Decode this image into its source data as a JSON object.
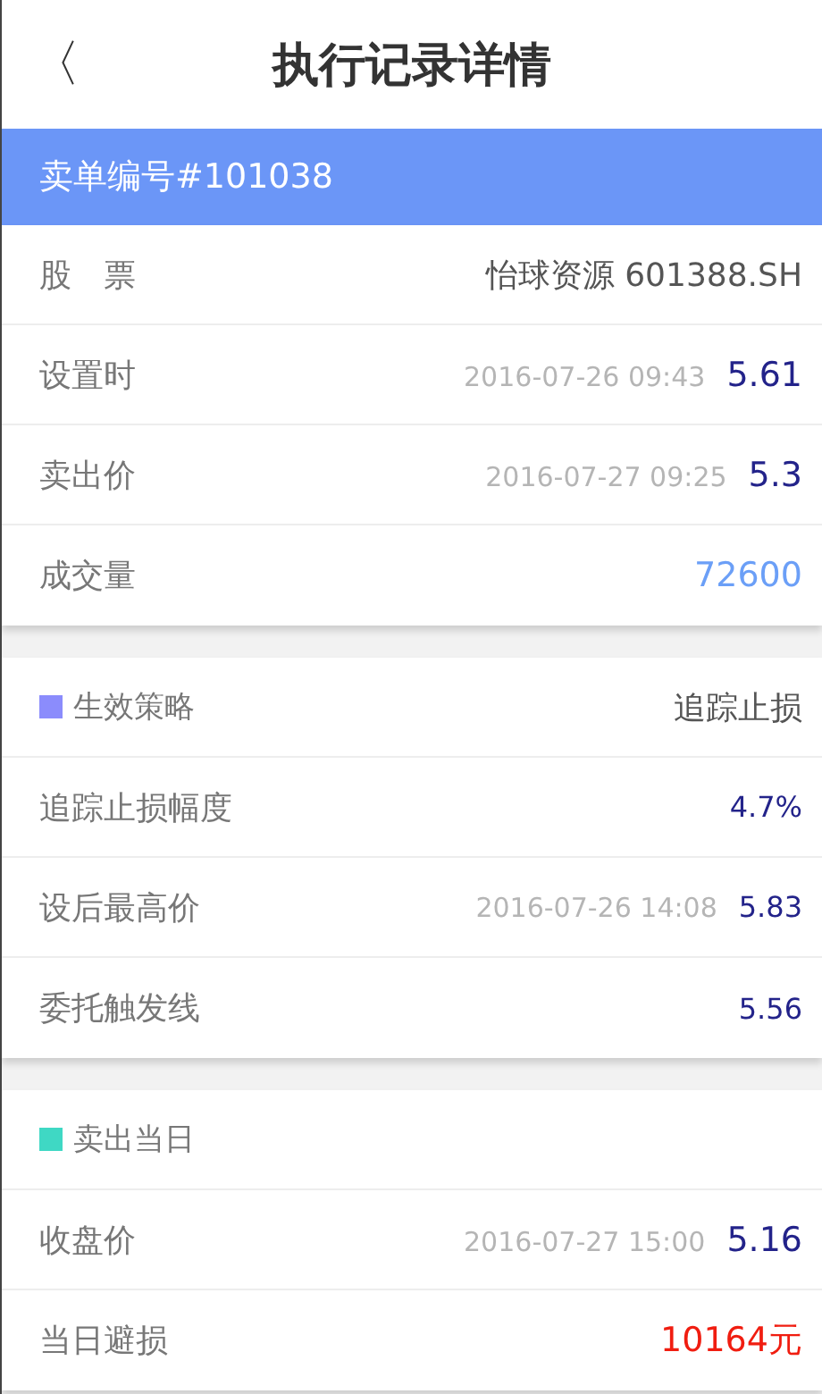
{
  "header": {
    "back": "〈",
    "title": "执行记录详情"
  },
  "order_bar": {
    "title": "卖单编号#101038"
  },
  "sections": [
    {
      "rows": [
        {
          "label": "股　票",
          "value": "怡球资源 601388.SH",
          "kind": "text"
        },
        {
          "label": "设置时",
          "time": "2016-07-26 09:43",
          "value": "5.61",
          "kind": "price"
        },
        {
          "label": "卖出价",
          "time": "2016-07-27 09:25",
          "value": "5.3",
          "kind": "price"
        },
        {
          "label": "成交量",
          "value": "72600",
          "kind": "volume"
        }
      ]
    },
    {
      "heading": {
        "label": "生效策略",
        "color": "#8b8cfc",
        "value": "追踪止损"
      },
      "rows": [
        {
          "label": "追踪止损幅度",
          "value": "4.7%",
          "kind": "small"
        },
        {
          "label": "设后最高价",
          "time": "2016-07-26 14:08",
          "value": "5.83",
          "kind": "small"
        },
        {
          "label": "委托触发线",
          "value": "5.56",
          "kind": "small"
        }
      ]
    },
    {
      "heading": {
        "label": "卖出当日",
        "color": "#3fd8c4"
      },
      "rows": [
        {
          "label": "收盘价",
          "time": "2016-07-27 15:00",
          "value": "5.16",
          "kind": "price"
        },
        {
          "label": "当日避损",
          "value": "10164元",
          "kind": "loss"
        }
      ]
    }
  ]
}
